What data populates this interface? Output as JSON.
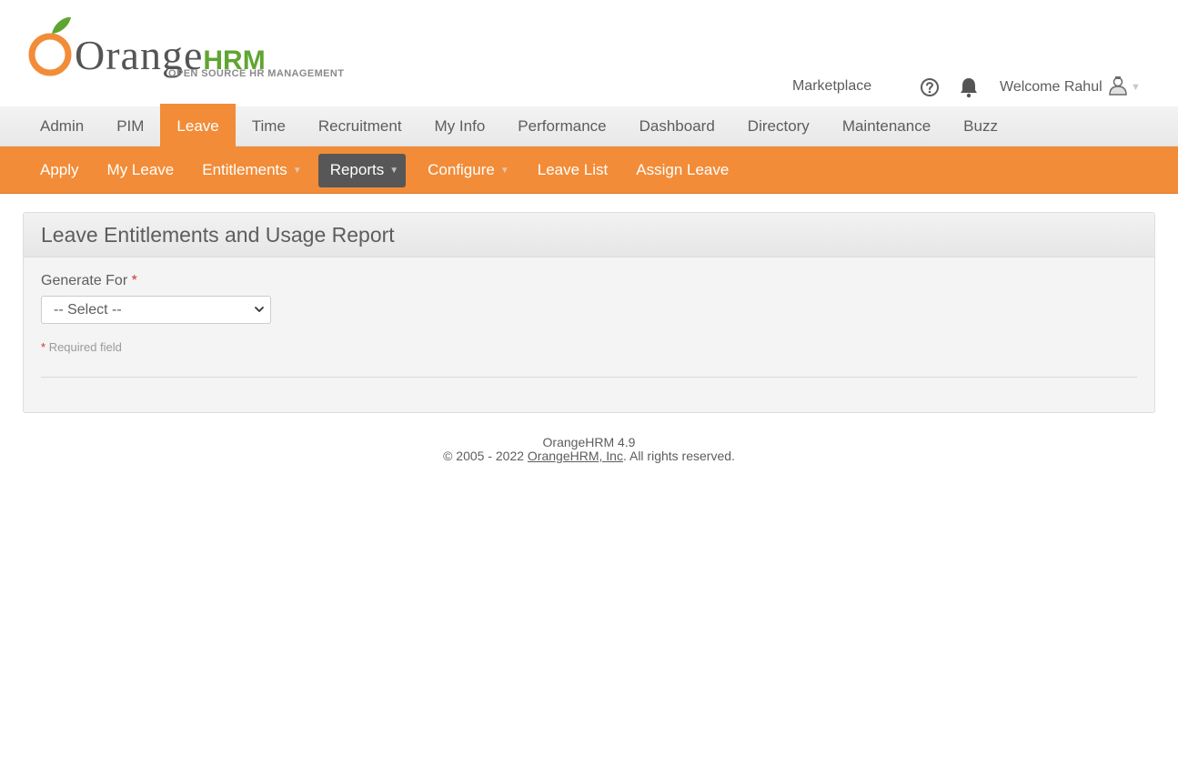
{
  "brand": {
    "logo_word": "Orange",
    "logo_hrm": "HRM",
    "logo_tagline": "OPEN SOURCE HR MANAGEMENT",
    "accent_color": "#f28c38",
    "green_color": "#5fa532"
  },
  "topbar": {
    "marketplace": "Marketplace",
    "help_icon": "help-circle-icon",
    "bell_icon": "bell-icon",
    "welcome": "Welcome Rahul",
    "avatar_icon": "user-avatar-icon"
  },
  "mainmenu": {
    "items": [
      {
        "label": "Admin"
      },
      {
        "label": "PIM"
      },
      {
        "label": "Leave"
      },
      {
        "label": "Time"
      },
      {
        "label": "Recruitment"
      },
      {
        "label": "My Info"
      },
      {
        "label": "Performance"
      },
      {
        "label": "Dashboard"
      },
      {
        "label": "Directory"
      },
      {
        "label": "Maintenance"
      },
      {
        "label": "Buzz"
      }
    ],
    "active": "Leave"
  },
  "submenu": {
    "items": [
      {
        "label": "Apply"
      },
      {
        "label": "My Leave"
      },
      {
        "label": "Entitlements"
      },
      {
        "label": "Reports"
      },
      {
        "label": "Configure"
      },
      {
        "label": "Leave List"
      },
      {
        "label": "Assign Leave"
      }
    ],
    "active": "Reports"
  },
  "panel": {
    "title": "Leave Entitlements and Usage Report",
    "generate_for_label": "Generate For",
    "required_star": "*",
    "select_value": "-- Select --",
    "required_note": "Required field"
  },
  "footer": {
    "version": "OrangeHRM 4.9",
    "copyright_prefix": "© 2005 - 2022 ",
    "company_link": "OrangeHRM, Inc",
    "copyright_suffix": ". All rights reserved."
  }
}
